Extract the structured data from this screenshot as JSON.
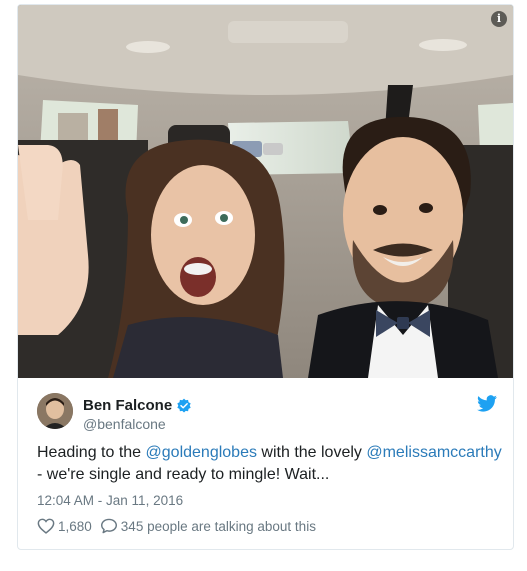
{
  "tweet": {
    "author_name": "Ben Falcone",
    "handle": "@benfalcone",
    "verified": true,
    "text_parts": {
      "pre": "Heading to the ",
      "mention1": "@goldenglobes",
      "mid": " with the lovely ",
      "mention2": "@melissamccarthy",
      "post": " - we're single and ready to mingle! Wait..."
    },
    "timestamp": "12:04 AM - Jan 11, 2016",
    "likes": "1,680",
    "talking": "345 people are talking about this"
  },
  "media": {
    "info_label": "i",
    "alt": "photo"
  },
  "colors": {
    "link": "#2b7bb9",
    "twitter_blue": "#1da1f2",
    "muted": "#697882",
    "border": "#e1e8ed"
  },
  "icons": {
    "verified": "verified-badge-icon",
    "bird": "twitter-bird-icon",
    "like": "heart-icon",
    "reply": "speech-bubble-icon"
  }
}
